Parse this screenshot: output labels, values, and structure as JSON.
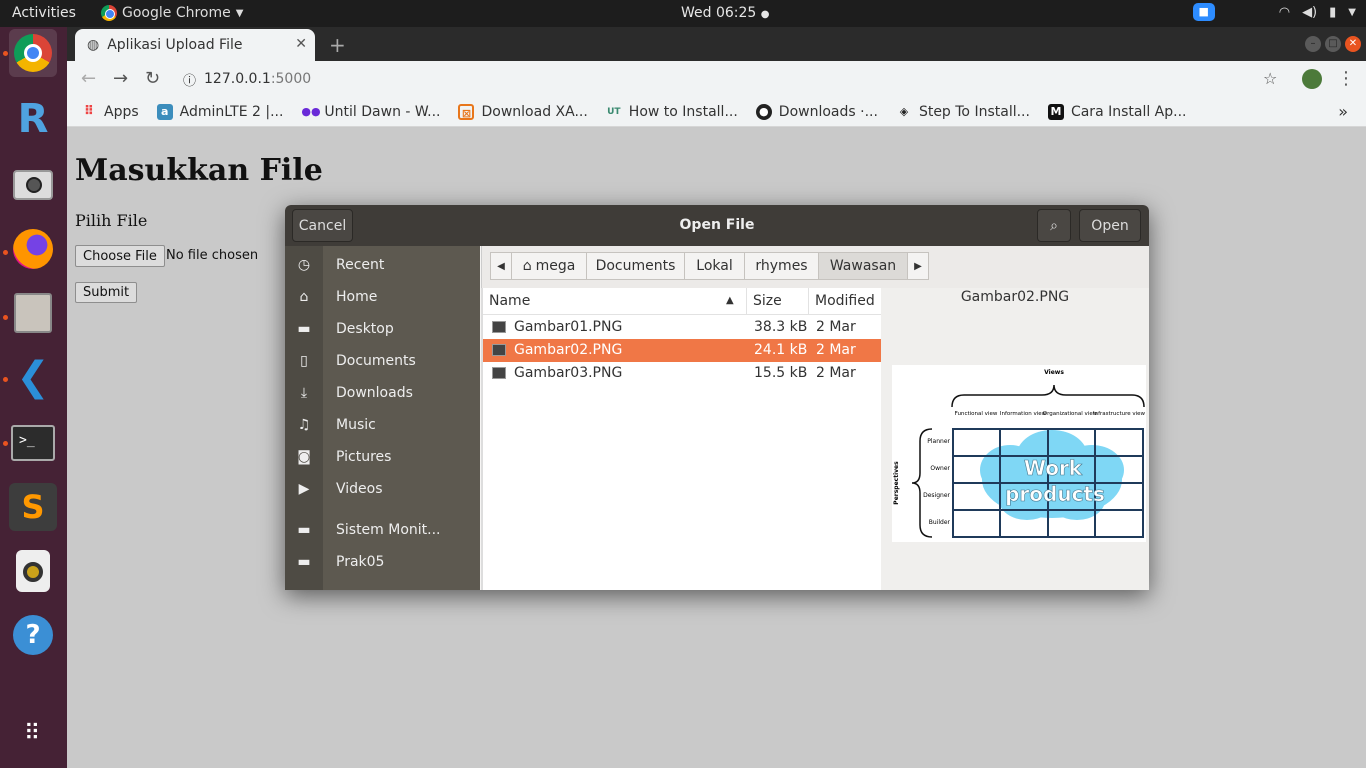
{
  "topbar": {
    "activities": "Activities",
    "app_name": "Google Chrome",
    "clock": "Wed 06:25"
  },
  "chrome": {
    "tab_title": "Aplikasi Upload File",
    "url_host": "127.0.0.1",
    "url_port": ":5000",
    "bookmarks": [
      {
        "label": "Apps",
        "icon": "apps-grid-icon"
      },
      {
        "label": "AdminLTE 2 |...",
        "icon": "adminlte-icon"
      },
      {
        "label": "Until Dawn - W...",
        "icon": "until-dawn-icon"
      },
      {
        "label": "Download XA...",
        "icon": "xampp-icon"
      },
      {
        "label": "How to Install...",
        "icon": "ut-icon"
      },
      {
        "label": "Downloads ·...",
        "icon": "github-icon"
      },
      {
        "label": "Step To Install...",
        "icon": "step-icon"
      },
      {
        "label": "Cara Install Ap...",
        "icon": "medium-icon"
      }
    ]
  },
  "page": {
    "heading": "Masukkan File",
    "label": "Pilih File",
    "choose_button": "Choose File",
    "no_file": "No file chosen",
    "submit": "Submit"
  },
  "dialog": {
    "title": "Open File",
    "cancel": "Cancel",
    "open": "Open",
    "places": [
      {
        "label": "Recent",
        "icon": "clock-icon"
      },
      {
        "label": "Home",
        "icon": "home-icon"
      },
      {
        "label": "Desktop",
        "icon": "folder-icon"
      },
      {
        "label": "Documents",
        "icon": "document-icon"
      },
      {
        "label": "Downloads",
        "icon": "download-icon"
      },
      {
        "label": "Music",
        "icon": "music-icon"
      },
      {
        "label": "Pictures",
        "icon": "camera-icon"
      },
      {
        "label": "Videos",
        "icon": "video-icon"
      },
      {
        "label": "Sistem Monit...",
        "icon": "folder-icon"
      },
      {
        "label": "Prak05",
        "icon": "folder-icon"
      }
    ],
    "path": [
      "mega",
      "Documents",
      "Lokal",
      "rhymes",
      "Wawasan"
    ],
    "columns": {
      "name": "Name",
      "size": "Size",
      "modified": "Modified"
    },
    "files": [
      {
        "name": "Gambar01.PNG",
        "size": "38.3 kB",
        "modified": "2 Mar"
      },
      {
        "name": "Gambar02.PNG",
        "size": "24.1 kB",
        "modified": "2 Mar"
      },
      {
        "name": "Gambar03.PNG",
        "size": "15.5 kB",
        "modified": "2 Mar"
      }
    ],
    "selected_index": 1,
    "preview_name": "Gambar02.PNG",
    "preview": {
      "views_title": "Views",
      "views": [
        "Functional view",
        "Information view",
        "Organizational view",
        "Infrastructure view"
      ],
      "perspectives_title": "Perspectives",
      "perspectives": [
        "Planner",
        "Owner",
        "Designer",
        "Builder"
      ],
      "cloud_line1": "Work",
      "cloud_line2": "products"
    },
    "accent": "#f07746"
  }
}
